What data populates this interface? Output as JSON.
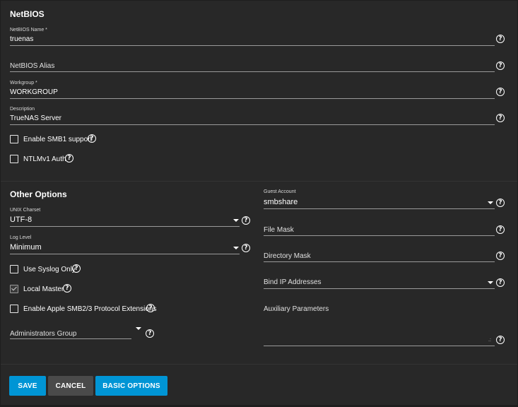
{
  "netbios": {
    "title": "NetBIOS",
    "name_label": "NetBIOS Name *",
    "name_value": "truenas",
    "alias_placeholder": "NetBIOS Alias",
    "workgroup_label": "Workgroup *",
    "workgroup_value": "WORKGROUP",
    "description_label": "Description",
    "description_value": "TrueNAS Server",
    "smb1_label": "Enable SMB1 support",
    "smb1_checked": false,
    "ntlm_label": "NTLMv1 Auth",
    "ntlm_checked": false
  },
  "other": {
    "title": "Other Options",
    "unix_charset_label": "UNIX Charset",
    "unix_charset_value": "UTF-8",
    "log_level_label": "Log Level",
    "log_level_value": "Minimum",
    "syslog_label": "Use Syslog Only",
    "syslog_checked": false,
    "local_master_label": "Local Master",
    "local_master_checked": true,
    "apple_label": "Enable Apple SMB2/3 Protocol Extensions",
    "apple_checked": false,
    "admin_group_placeholder": "Administrators Group",
    "guest_account_label": "Guest Account",
    "guest_account_value": "smbshare",
    "file_mask_placeholder": "File Mask",
    "dir_mask_placeholder": "Directory Mask",
    "bind_ip_placeholder": "Bind IP Addresses",
    "aux_params_placeholder": "Auxiliary Parameters"
  },
  "buttons": {
    "save": "SAVE",
    "cancel": "CANCEL",
    "basic": "BASIC OPTIONS"
  },
  "icons": {
    "help": "?",
    "textarea_resize": ".:"
  },
  "colors": {
    "primary": "#0095d5",
    "secondary": "#4a4a4a",
    "panel": "#282828"
  }
}
